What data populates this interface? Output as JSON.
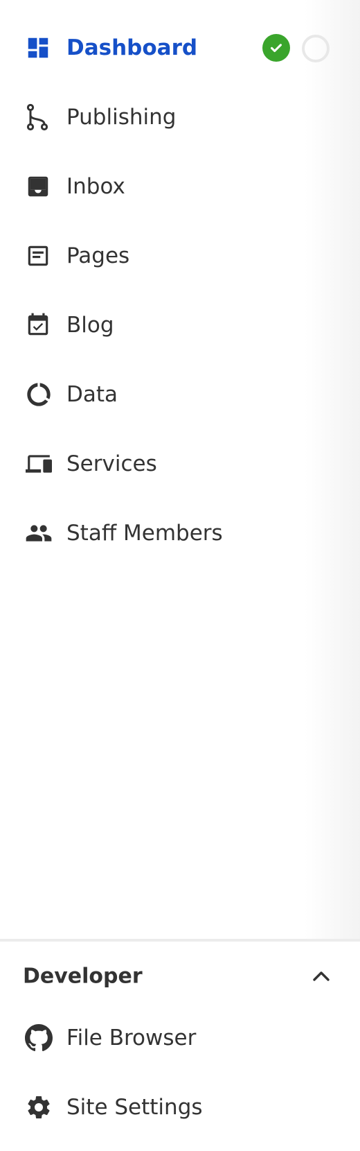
{
  "nav": {
    "items": [
      {
        "label": "Dashboard",
        "icon": "dashboard-icon"
      },
      {
        "label": "Publishing",
        "icon": "branch-icon"
      },
      {
        "label": "Inbox",
        "icon": "inbox-icon"
      },
      {
        "label": "Pages",
        "icon": "page-icon"
      },
      {
        "label": "Blog",
        "icon": "calendar-check-icon"
      },
      {
        "label": "Data",
        "icon": "donut-icon"
      },
      {
        "label": "Services",
        "icon": "devices-icon"
      },
      {
        "label": "Staff Members",
        "icon": "people-icon"
      }
    ]
  },
  "status": {
    "check_color": "#3aa52c",
    "empty_color": "#e8e8e8"
  },
  "developer": {
    "title": "Developer",
    "items": [
      {
        "label": "File Browser",
        "icon": "github-icon"
      },
      {
        "label": "Site Settings",
        "icon": "gear-icon"
      }
    ]
  },
  "colors": {
    "accent": "#1650c8",
    "text": "#333333"
  }
}
